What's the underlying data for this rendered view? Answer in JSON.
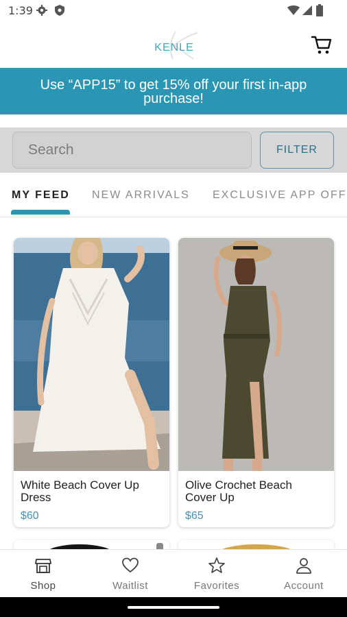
{
  "status_bar": {
    "time": "1:39",
    "left_icons": [
      "gear-icon",
      "shield-icon"
    ],
    "right_icons": [
      "wifi-icon",
      "signal-icon",
      "battery-icon"
    ]
  },
  "header": {
    "logo_text": "KENLE",
    "cart_icon": "cart-icon"
  },
  "promo": {
    "text": "Use “APP15” to get 15% off your first in-app purchase!",
    "color": "#2b95b4"
  },
  "search": {
    "placeholder": "Search",
    "filter_label": "FILTER"
  },
  "tabs": [
    {
      "label": "MY FEED",
      "active": true
    },
    {
      "label": "NEW ARRIVALS",
      "active": false
    },
    {
      "label": "EXCLUSIVE APP OFF",
      "active": false
    }
  ],
  "products": [
    {
      "name": "White Beach Cover Up Dress",
      "price": "$60"
    },
    {
      "name": "Olive Crochet Beach Cover Up",
      "price": "$65"
    }
  ],
  "bottom_nav": [
    {
      "label": "Shop",
      "icon": "shop-icon",
      "active": true
    },
    {
      "label": "Waitlist",
      "icon": "heart-icon",
      "active": false
    },
    {
      "label": "Favorites",
      "icon": "star-icon",
      "active": false
    },
    {
      "label": "Account",
      "icon": "account-icon",
      "active": false
    }
  ],
  "colors": {
    "accent": "#2b95b4",
    "price": "#4a8fb0"
  }
}
